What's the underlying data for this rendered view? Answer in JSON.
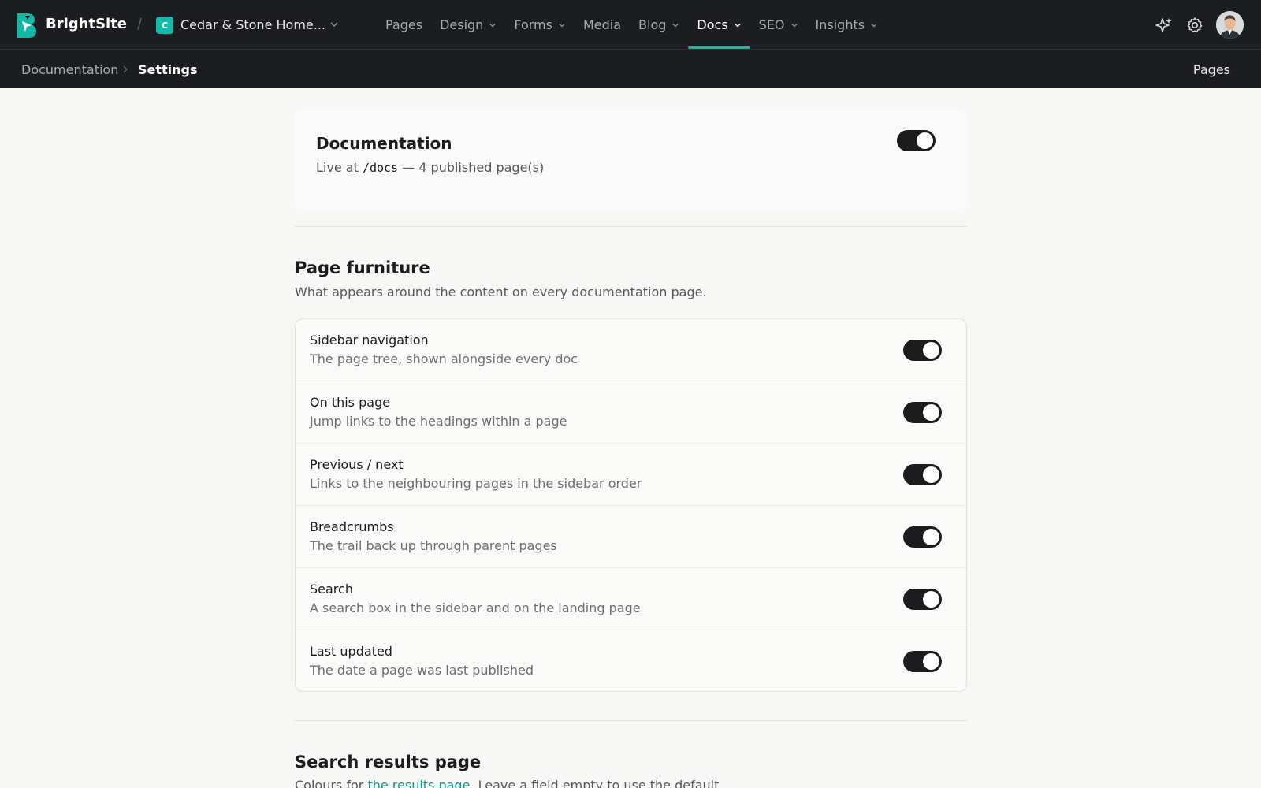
{
  "app": {
    "name": "BrightSite"
  },
  "site": {
    "badge": "C",
    "name": "Cedar & Stone Home..."
  },
  "nav": {
    "items": [
      {
        "label": "Pages",
        "dropdown": false,
        "active": false
      },
      {
        "label": "Design",
        "dropdown": true,
        "active": false
      },
      {
        "label": "Forms",
        "dropdown": true,
        "active": false
      },
      {
        "label": "Media",
        "dropdown": false,
        "active": false
      },
      {
        "label": "Blog",
        "dropdown": true,
        "active": false
      },
      {
        "label": "Docs",
        "dropdown": true,
        "active": true
      },
      {
        "label": "SEO",
        "dropdown": true,
        "active": false
      },
      {
        "label": "Insights",
        "dropdown": true,
        "active": false
      }
    ],
    "icons": [
      "sparkle-icon",
      "gear-icon",
      "avatar"
    ]
  },
  "breadcrumb": {
    "parent": "Documentation",
    "current": "Settings",
    "right_link": "Pages"
  },
  "hero": {
    "title": "Documentation",
    "sub_prefix": "Live at",
    "path": "/docs",
    "sub_suffix": "— 4 published page(s)",
    "enabled": true
  },
  "furniture": {
    "title": "Page furniture",
    "description": "What appears around the content on every documentation page.",
    "rows": [
      {
        "title": "Sidebar navigation",
        "desc": "The page tree, shown alongside every doc",
        "enabled": true
      },
      {
        "title": "On this page",
        "desc": "Jump links to the headings within a page",
        "enabled": true
      },
      {
        "title": "Previous / next",
        "desc": "Links to the neighbouring pages in the sidebar order",
        "enabled": true
      },
      {
        "title": "Breadcrumbs",
        "desc": "The trail back up through parent pages",
        "enabled": true
      },
      {
        "title": "Search",
        "desc": "A search box in the sidebar and on the landing page",
        "enabled": true
      },
      {
        "title": "Last updated",
        "desc": "The date a page was last published",
        "enabled": true
      }
    ]
  },
  "search_results": {
    "title": "Search results page",
    "desc_prefix": "Colours for",
    "desc_link": "the results page",
    "desc_suffix": ". Leave a field empty to use the default."
  },
  "colors": {
    "accent": "#14b8a6",
    "toggle_on": "#1c1c1e",
    "nav_bg": "#1b1d20"
  }
}
